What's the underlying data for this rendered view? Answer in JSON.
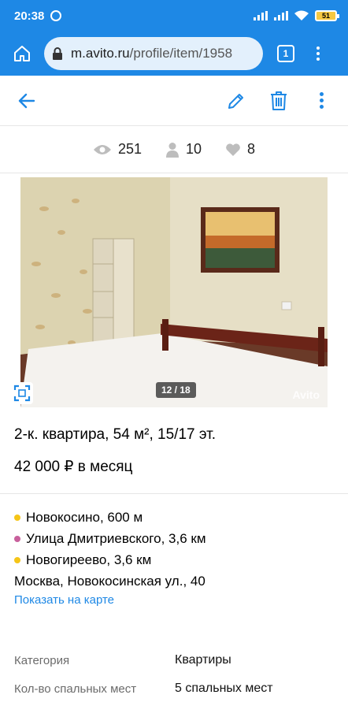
{
  "status_bar": {
    "time": "20:38",
    "battery": "51"
  },
  "browser": {
    "url_domain": "m.avito.ru",
    "url_path": "/profile/item/1958",
    "tab_count": "1"
  },
  "stats": {
    "views": "251",
    "contacts": "10",
    "favorites": "8"
  },
  "gallery": {
    "counter": "12 / 18",
    "watermark": "Avito"
  },
  "listing": {
    "title": "2-к. квартира, 54 м², 15/17 эт.",
    "price": "42 000 ₽ в месяц",
    "metro": [
      {
        "name": "Новокосино, 600 м",
        "color": "#f5c518"
      },
      {
        "name": "Улица Дмитриевского, 3,6 км",
        "color": "#c8609c"
      },
      {
        "name": "Новогиреево, 3,6 км",
        "color": "#f5c518"
      }
    ],
    "address": "Москва, Новокосинская ул., 40",
    "map_link": "Показать на карте"
  },
  "params": [
    {
      "key": "Категория",
      "value": "Квартиры"
    },
    {
      "key": "Кол-во спальных мест",
      "value": "5 спальных мест"
    }
  ],
  "colors": {
    "accent": "#1e88e5"
  }
}
